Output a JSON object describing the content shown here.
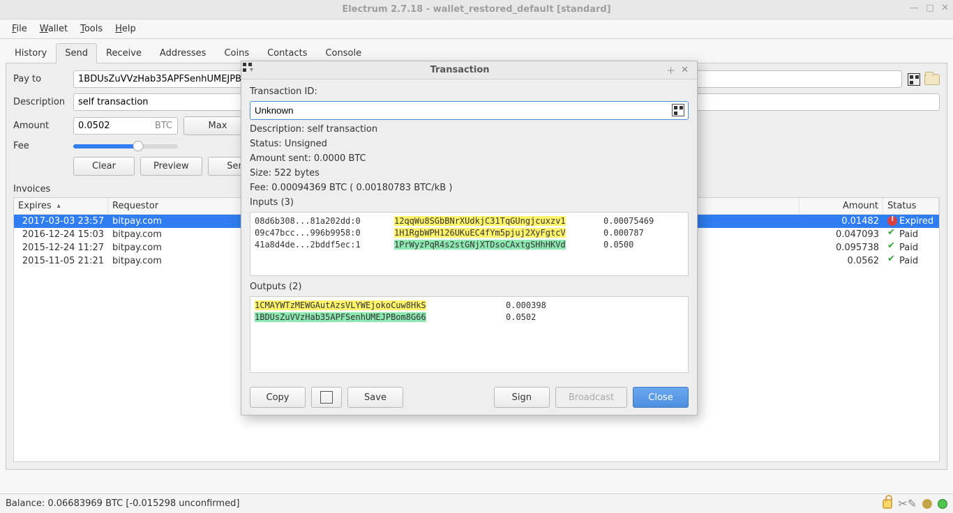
{
  "window": {
    "title": "Electrum 2.7.18  -  wallet_restored_default  [standard]"
  },
  "menus": {
    "file": "File",
    "wallet": "Wallet",
    "tools": "Tools",
    "help": "Help",
    "file_u": "F",
    "wallet_u": "W",
    "tools_u": "T",
    "help_u": "H"
  },
  "tabs": [
    "History",
    "Send",
    "Receive",
    "Addresses",
    "Coins",
    "Contacts",
    "Console"
  ],
  "send": {
    "payto_label": "Pay to",
    "payto_value": "1BDUsZuVVzHab35APFSenhUMEJPBom8G66",
    "desc_label": "Description",
    "desc_value": "self transaction",
    "amount_label": "Amount",
    "amount_value": "0.0502",
    "amount_unit": "BTC",
    "max": "Max",
    "fee_label": "Fee",
    "clear": "Clear",
    "preview": "Preview",
    "send": "Send"
  },
  "invoices_label": "Invoices",
  "inv_cols": {
    "expires": "Expires",
    "requestor": "Requestor",
    "amount": "Amount",
    "status": "Status"
  },
  "invoices": [
    {
      "exp": "2017-03-03 23:57",
      "req": "bitpay.com",
      "amt": "0.01482",
      "stat": "Expired",
      "stclass": "expired"
    },
    {
      "exp": "2016-12-24 15:03",
      "req": "bitpay.com",
      "amt": "0.047093",
      "stat": "Paid",
      "stclass": "paid"
    },
    {
      "exp": "2015-12-24 11:27",
      "req": "bitpay.com",
      "amt": "0.095738",
      "stat": "Paid",
      "stclass": "paid"
    },
    {
      "exp": "2015-11-05 21:21",
      "req": "bitpay.com",
      "amt": "0.0562",
      "stat": "Paid",
      "stclass": "paid"
    }
  ],
  "dialog": {
    "title": "Transaction",
    "txid_label": "Transaction ID:",
    "txid_value": "Unknown",
    "desc": "Description: self transaction",
    "status": "Status: Unsigned",
    "amount": "Amount sent: 0.0000 BTC",
    "size": "Size: 522 bytes",
    "fee": "Fee: 0.00094369 BTC  ( 0.00180783 BTC/kB )",
    "inputs_header": "Inputs (3)",
    "inputs": [
      {
        "prev": "08d6b308...81a202dd:0",
        "addr": "12qqWu8SGbBNrXUdkjC31TqGUngjcuxzv1",
        "hl": "yellow",
        "amt": "0.00075469"
      },
      {
        "prev": "09c47bcc...996b9958:0",
        "addr": "1H1RgbWPH126UKuEC4fYm5pjuj2XyFgtcV",
        "hl": "yellow",
        "amt": "0.000787"
      },
      {
        "prev": "41a8d4de...2bddf5ec:1",
        "addr": "1PrWyzPqR4s2stGNjXTDsoCAxtgSHhHKVd",
        "hl": "green",
        "amt": "0.0500"
      }
    ],
    "outputs_header": "Outputs (2)",
    "outputs": [
      {
        "addr": "1CMAYWTzMEWGAutAzsVLYWEjokoCuw8HkS",
        "hl": "yellow",
        "amt": "0.000398"
      },
      {
        "addr": "1BDUsZuVVzHab35APFSenhUMEJPBom8G66",
        "hl": "green",
        "amt": "0.0502"
      }
    ],
    "buttons": {
      "copy": "Copy",
      "save": "Save",
      "sign": "Sign",
      "broadcast": "Broadcast",
      "close": "Close"
    }
  },
  "status": {
    "balance": "Balance: 0.06683969 BTC  [-0.015298 unconfirmed]"
  }
}
